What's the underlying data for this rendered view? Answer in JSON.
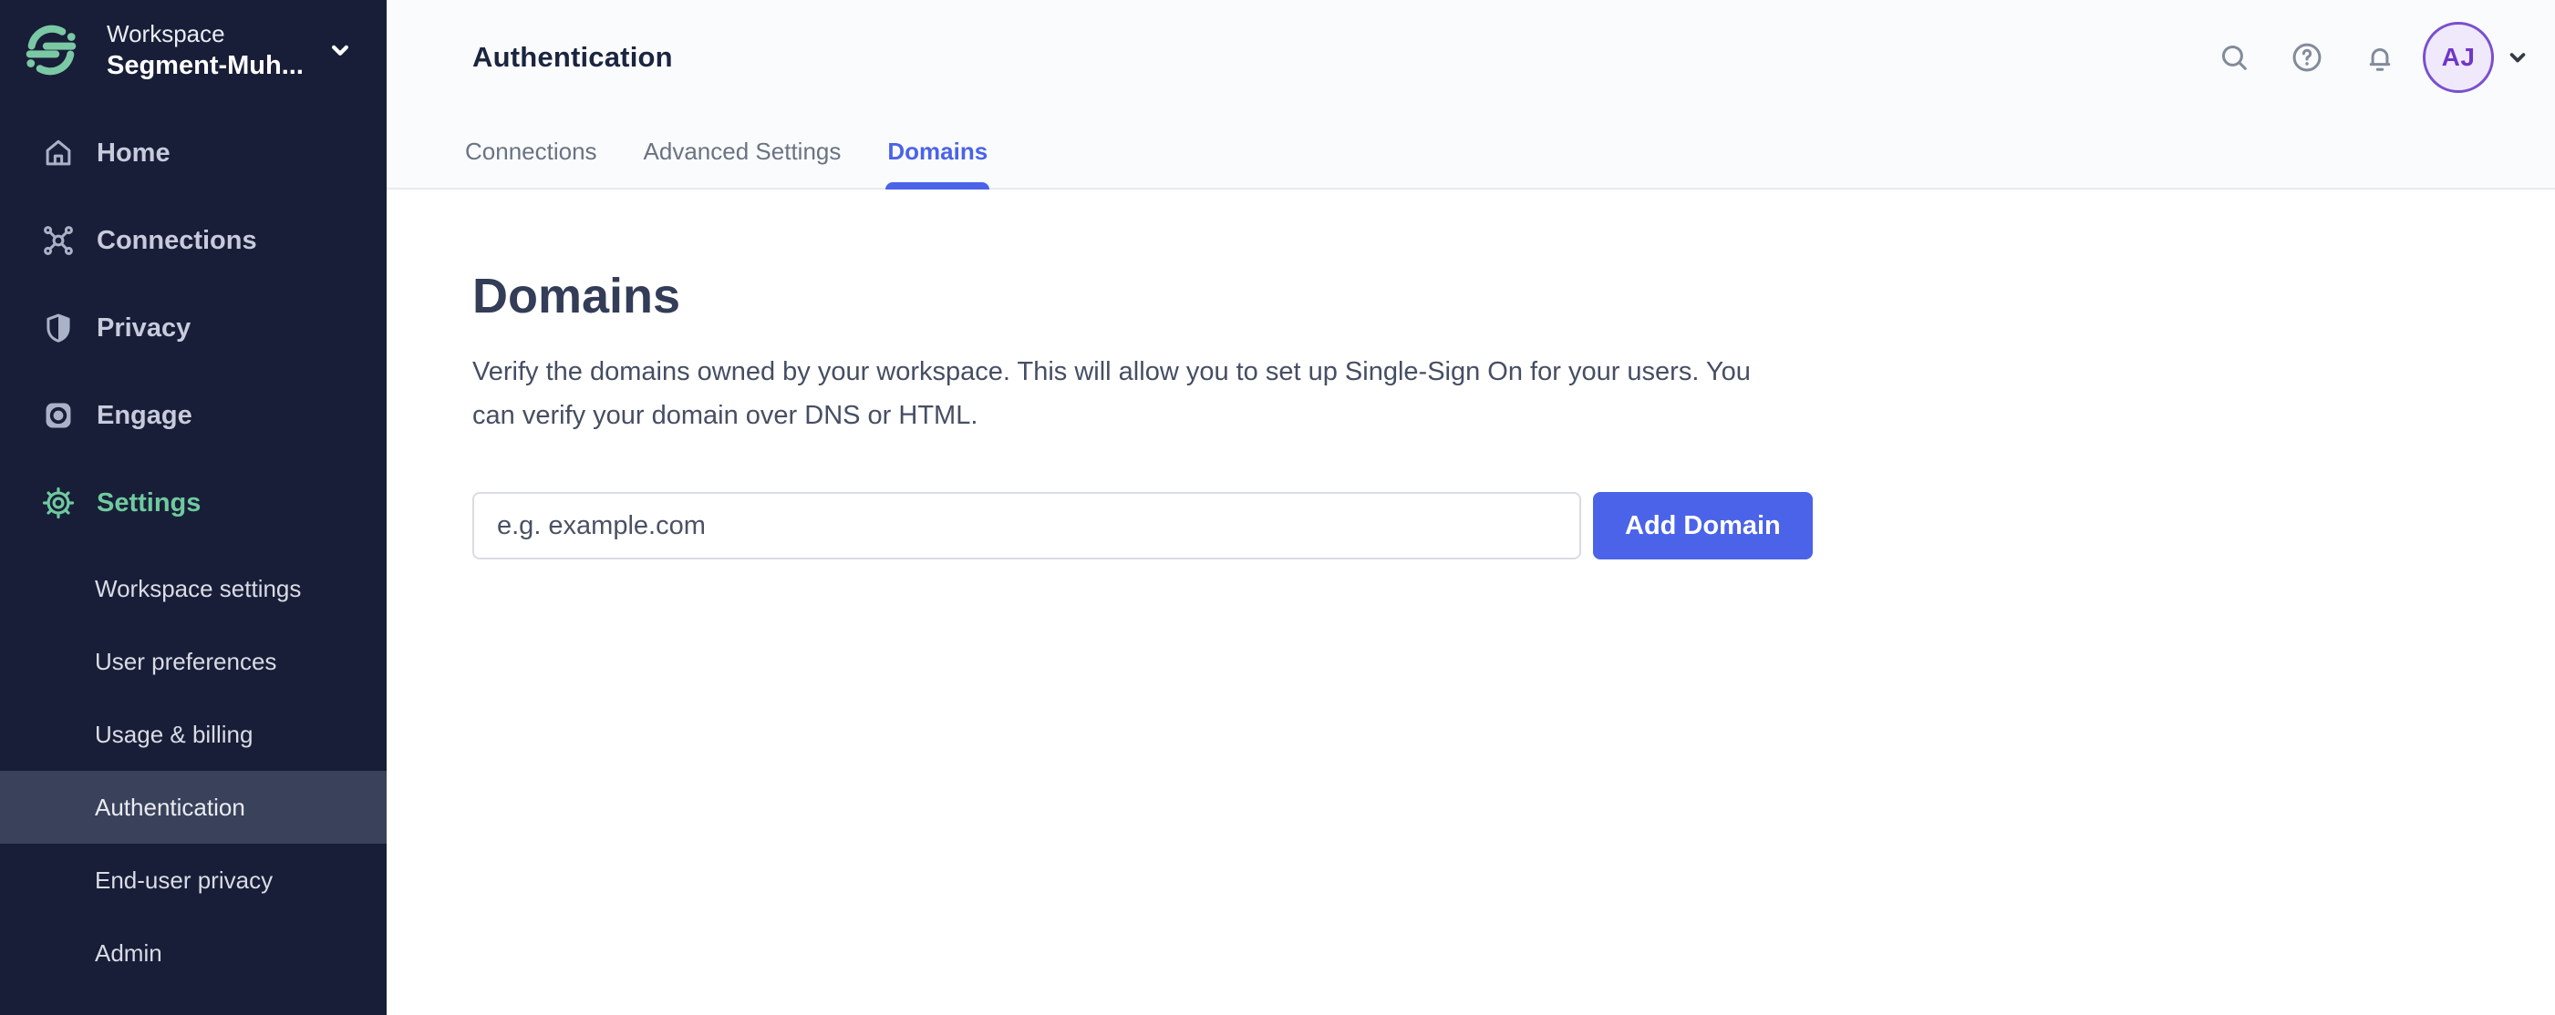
{
  "sidebar": {
    "workspace": {
      "label": "Workspace",
      "name": "Segment-Muh..."
    },
    "items": [
      {
        "label": "Home",
        "icon": "home-icon",
        "active": false
      },
      {
        "label": "Connections",
        "icon": "connections-icon",
        "active": false
      },
      {
        "label": "Privacy",
        "icon": "shield-icon",
        "active": false
      },
      {
        "label": "Engage",
        "icon": "engage-icon",
        "active": false
      },
      {
        "label": "Settings",
        "icon": "gear-icon",
        "active": true
      }
    ],
    "sub_items": [
      {
        "label": "Workspace settings",
        "selected": false
      },
      {
        "label": "User preferences",
        "selected": false
      },
      {
        "label": "Usage & billing",
        "selected": false
      },
      {
        "label": "Authentication",
        "selected": true
      },
      {
        "label": "End-user privacy",
        "selected": false
      },
      {
        "label": "Admin",
        "selected": false
      }
    ]
  },
  "header": {
    "title": "Authentication",
    "avatar_initials": "AJ",
    "tabs": [
      {
        "label": "Connections",
        "active": false
      },
      {
        "label": "Advanced Settings",
        "active": false
      },
      {
        "label": "Domains",
        "active": true
      }
    ]
  },
  "main": {
    "heading": "Domains",
    "description": "Verify the domains owned by your workspace. This will allow you to set up Single-Sign On for your users. You can verify your domain over DNS or HTML.",
    "input_value": "",
    "input_placeholder": "e.g. example.com",
    "add_button_label": "Add Domain"
  },
  "colors": {
    "brand_green": "#7BC8A4",
    "sidebar_bg": "#181E38",
    "sidebar_highlight": "#3A415A",
    "accent_blue": "#4A63E8",
    "avatar_purple": "#7A4FD0",
    "header_bg": "#FAFBFC"
  }
}
